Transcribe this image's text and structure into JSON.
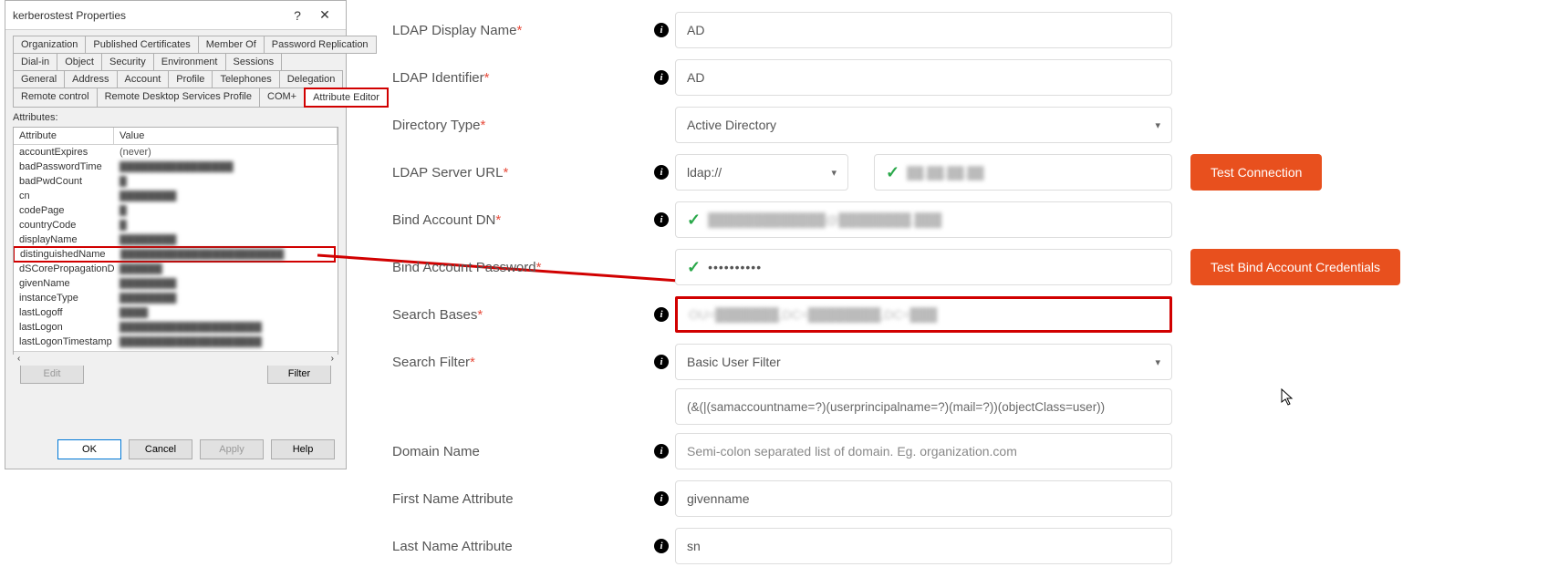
{
  "dialog": {
    "title": "kerberostest Properties",
    "tabs_row1": [
      "Organization",
      "Published Certificates",
      "Member Of",
      "Password Replication"
    ],
    "tabs_row2": [
      "Dial-in",
      "Object",
      "Security",
      "Environment",
      "Sessions"
    ],
    "tabs_row3": [
      "General",
      "Address",
      "Account",
      "Profile",
      "Telephones",
      "Delegation"
    ],
    "tabs_row4": [
      "Remote control",
      "Remote Desktop Services Profile",
      "COM+",
      "Attribute Editor"
    ],
    "active_tab": "Attribute Editor",
    "attributes_label": "Attributes:",
    "col_attribute": "Attribute",
    "col_value": "Value",
    "rows": [
      {
        "n": "accountExpires",
        "v": "(never)",
        "clear": true
      },
      {
        "n": "badPasswordTime",
        "v": "████████████████"
      },
      {
        "n": "badPwdCount",
        "v": "█"
      },
      {
        "n": "cn",
        "v": "████████"
      },
      {
        "n": "codePage",
        "v": "█"
      },
      {
        "n": "countryCode",
        "v": "█"
      },
      {
        "n": "displayName",
        "v": "████████"
      },
      {
        "n": "distinguishedName",
        "v": "███████████████████████",
        "hl": true
      },
      {
        "n": "dSCorePropagationD...",
        "v": "██████"
      },
      {
        "n": "givenName",
        "v": "████████"
      },
      {
        "n": "instanceType",
        "v": "████████"
      },
      {
        "n": "lastLogoff",
        "v": "████"
      },
      {
        "n": "lastLogon",
        "v": "████████████████████"
      },
      {
        "n": "lastLogonTimestamp",
        "v": "████████████████████"
      }
    ],
    "edit_btn": "Edit",
    "filter_btn": "Filter",
    "ok": "OK",
    "cancel": "Cancel",
    "apply": "Apply",
    "help": "Help"
  },
  "form": {
    "ldap_display_name": {
      "label": "LDAP Display Name",
      "value": "AD"
    },
    "ldap_identifier": {
      "label": "LDAP Identifier",
      "value": "AD"
    },
    "directory_type": {
      "label": "Directory Type",
      "value": "Active Directory"
    },
    "ldap_server_url": {
      "label": "LDAP Server URL",
      "scheme": "ldap://",
      "host": "██.██.██.██"
    },
    "test_connection": "Test Connection",
    "bind_dn": {
      "label": "Bind Account DN",
      "value": "█████████████@████████.███"
    },
    "bind_pw": {
      "label": "Bind Account Password",
      "value": "••••••••••"
    },
    "test_bind": "Test Bind Account Credentials",
    "search_bases": {
      "label": "Search Bases",
      "value": "OU=███████,DC=████████,DC=███"
    },
    "search_filter": {
      "label": "Search Filter",
      "value": "Basic User Filter"
    },
    "filter_string": "(&(|(samaccountname=?)(userprincipalname=?)(mail=?))(objectClass=user))",
    "domain_name": {
      "label": "Domain Name",
      "placeholder": "Semi-colon separated list of domain. Eg. organization.com"
    },
    "first_name": {
      "label": "First Name Attribute",
      "value": "givenname"
    },
    "last_name": {
      "label": "Last Name Attribute",
      "value": "sn"
    }
  }
}
